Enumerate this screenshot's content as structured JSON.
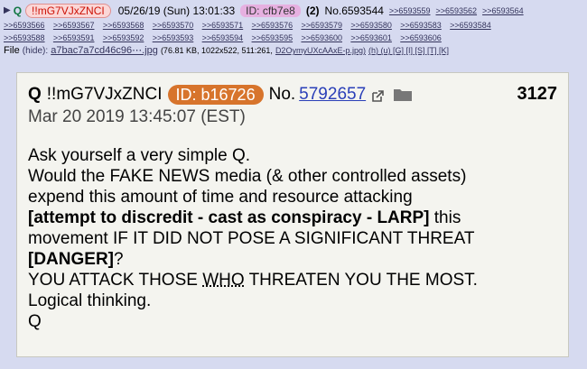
{
  "header": {
    "arrow": "▶",
    "name": "Q",
    "tripcode": "!!mG7VJxZNCI",
    "datetime": "05/26/19 (Sun) 13:01:33",
    "id_label": "ID: cfb7e8",
    "reply_count": "(2)",
    "post_no": "No.6593544",
    "backlinks_row1": [
      ">>6593559",
      ">>6593562",
      ">>6593564"
    ],
    "backlinks_row2": [
      ">>6593566",
      ">>6593567",
      ">>6593568",
      ">>6593570",
      ">>6593571",
      ">>6593576",
      ">>6593579",
      ">>6593580",
      ">>6593583",
      ">>6593584"
    ],
    "backlinks_row3": [
      ">>6593588",
      ">>6593591",
      ">>6593592",
      ">>6593593",
      ">>6593594",
      ">>6593595",
      ">>6593600",
      ">>6593601",
      ">>6593606"
    ],
    "file_label": "File",
    "hide": "(hide):",
    "file_name": "a7bac7a7cd46c96⋯.jpg",
    "file_meta": "(76.81 KB, 1022x522, 511:261,",
    "file_source": "D2OymyUXcAAxE-p.jpg)",
    "file_links": "(h) (u) [G] [I] [S] [T] [K]"
  },
  "card": {
    "name": "Q",
    "tripcode": "!!mG7VJxZNCI",
    "id_label": "ID: b16726",
    "no_label": "No.",
    "post_link": "5792657",
    "number": "3127",
    "date": "Mar 20 2019 13:45:07 (EST)",
    "lines": {
      "l1": "Ask yourself a very simple Q.",
      "l2": "Would the FAKE NEWS media (& other controlled assets)",
      "l3": "expend this amount of time and resource attacking",
      "l4_bold": "[attempt to discredit - cast as conspiracy - LARP]",
      "l4_rest": " this",
      "l5": "movement IF IT DID NOT POSE A SIGNIFICANT THREAT",
      "l6_bold": "[DANGER]",
      "l6_rest": "?",
      "l7_a": "YOU ATTACK THOSE ",
      "l7_who": "WHO",
      "l7_b": " THREATEN YOU THE MOST.",
      "l8": "Logical thinking.",
      "l9": "Q"
    }
  },
  "colors": {
    "background": "#d6daf0",
    "card": "#f4f4ef",
    "name_green": "#117743",
    "id_orange": "#d7742c",
    "link": "#34345c"
  }
}
